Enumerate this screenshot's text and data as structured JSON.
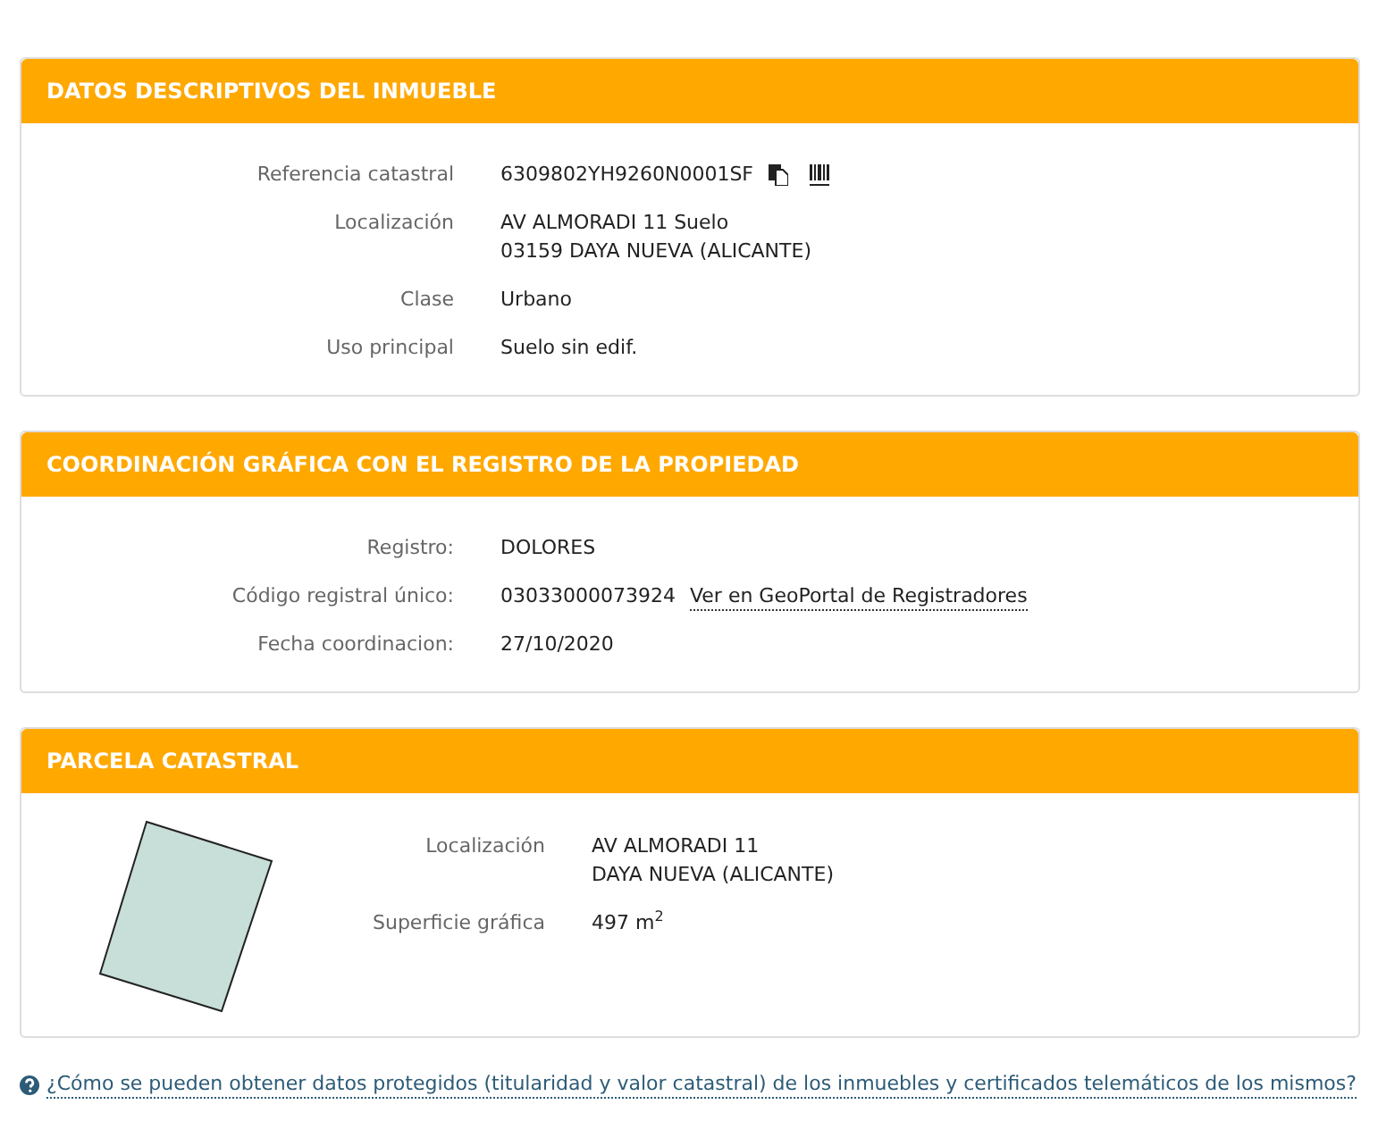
{
  "sections": [
    {
      "title": "DATOS DESCRIPTIVOS DEL INMUEBLE",
      "kind": "fields",
      "rows": [
        {
          "kind": "reference",
          "label": "Referencia catastral",
          "lines": [
            "6309802YH9260N0001SF"
          ]
        },
        {
          "kind": "plain",
          "label": "Localización",
          "lines": [
            "AV ALMORADI 11 Suelo",
            "03159 DAYA NUEVA (ALICANTE)"
          ]
        },
        {
          "kind": "plain",
          "label": "Clase",
          "lines": [
            "Urbano"
          ]
        },
        {
          "kind": "plain",
          "label": "Uso principal",
          "lines": [
            "Suelo sin edif."
          ]
        }
      ]
    },
    {
      "title": "COORDINACIÓN GRÁFICA CON EL REGISTRO DE LA PROPIEDAD",
      "kind": "fields",
      "rows": [
        {
          "kind": "plain",
          "label": "Registro:",
          "lines": [
            "DOLORES"
          ]
        },
        {
          "kind": "link",
          "label": "Código registral único:",
          "lines": [
            "03033000073924"
          ],
          "link": "Ver en GeoPortal de Registradores"
        },
        {
          "kind": "plain",
          "label": "Fecha coordinacion:",
          "lines": [
            "27/10/2020"
          ]
        }
      ]
    },
    {
      "title": "PARCELA CATASTRAL",
      "kind": "parcel",
      "rows": [
        {
          "kind": "plain",
          "label": "Localización",
          "lines": [
            "AV ALMORADI 11",
            "DAYA NUEVA (ALICANTE)"
          ]
        },
        {
          "kind": "plain",
          "label": "Superficie gráfica",
          "lines": [
            "497 m$^{2}$"
          ]
        }
      ]
    }
  ],
  "help_link": "¿Cómo se pueden obtener datos protegidos (titularidad y valor catastral) de los inmuebles y certificados telemáticos de los mismos?"
}
